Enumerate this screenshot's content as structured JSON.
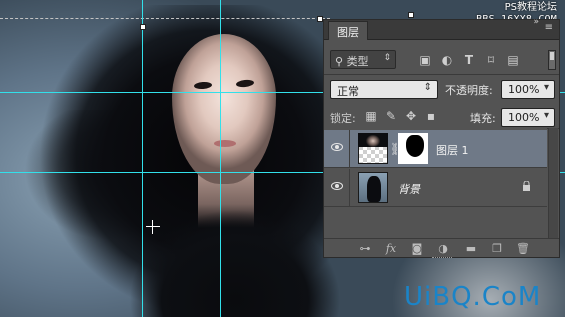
{
  "watermark": {
    "line1": "PS教程论坛",
    "line2": "BBS.16XX8.COM"
  },
  "logo_text": "UiBQ.CoM",
  "panel": {
    "tab_label": "图层",
    "filter": {
      "search_icon": "magnifier-icon",
      "kind_label": "类型"
    },
    "filter_icons": [
      "image-filter-icon",
      "adjustment-filter-icon",
      "type-filter-icon",
      "shape-filter-icon",
      "smart-object-filter-icon"
    ],
    "blend_mode": "正常",
    "opacity_label": "不透明度:",
    "opacity_value": "100%",
    "lock_label": "锁定:",
    "fill_label": "填充:",
    "fill_value": "100%",
    "layers": [
      {
        "name": "图层 1",
        "visible": true,
        "selected": true,
        "has_mask": true
      },
      {
        "name": "背景",
        "visible": true,
        "selected": false,
        "locked": true
      }
    ],
    "bottom_icons": [
      "link-layers-icon",
      "fx-icon",
      "add-mask-icon",
      "adjustment-layer-icon",
      "new-group-icon",
      "new-layer-icon",
      "delete-layer-icon"
    ]
  },
  "colors": {
    "guide": "#32e0ea",
    "panel_bg": "#535353",
    "selected_layer": "#6f7987",
    "logo": "#1a84c8"
  }
}
